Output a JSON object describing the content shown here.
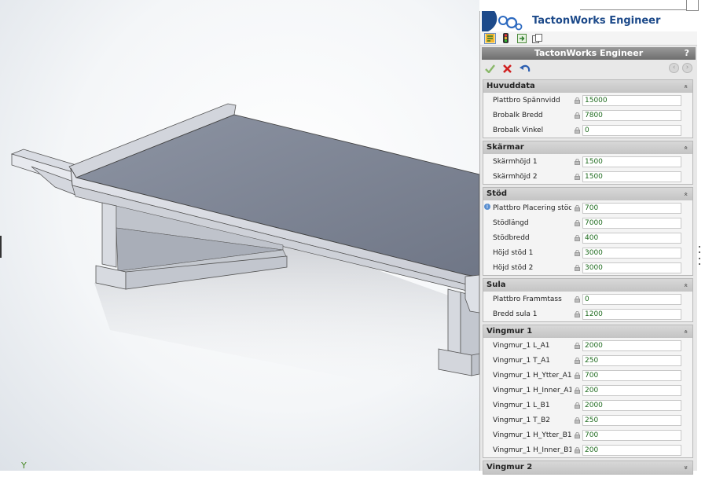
{
  "brand": {
    "name": "TactonWorks Engineer",
    "logo_icon": "tacton-logo-icon"
  },
  "toolbar": {
    "icons": [
      "configurator-icon",
      "traffic-light-icon",
      "export-icon",
      "copy-icon"
    ]
  },
  "panel": {
    "title": "TactonWorks Engineer",
    "help": "?"
  },
  "actions": {
    "accept_icon": "checkmark-icon",
    "cancel_icon": "x-icon",
    "undo_icon": "undo-icon",
    "prev_icon": "circle-left-icon",
    "next_icon": "circle-right-icon"
  },
  "colors": {
    "value_text": "#1e6b1e",
    "brand_text": "#1d4a8a",
    "title_bar": "#7a7a7a"
  },
  "groups": [
    {
      "title": "Huvuddata",
      "chevron": "«",
      "rows": [
        {
          "label": "Plattbro Spännvidd",
          "value": "15000"
        },
        {
          "label": "Brobalk Bredd",
          "value": "7800"
        },
        {
          "label": "Brobalk Vinkel",
          "value": "0"
        }
      ]
    },
    {
      "title": "Skärmar",
      "chevron": "«",
      "rows": [
        {
          "label": "Skärmhöjd 1",
          "value": "1500"
        },
        {
          "label": "Skärmhöjd 2",
          "value": "1500"
        }
      ]
    },
    {
      "title": "Stöd",
      "chevron": "«",
      "rows": [
        {
          "label": "Plattbro Placering stöd",
          "value": "700",
          "info": "i"
        },
        {
          "label": "Stödlängd",
          "value": "7000"
        },
        {
          "label": "Stödbredd",
          "value": "400"
        },
        {
          "label": "Höjd stöd 1",
          "value": "3000"
        },
        {
          "label": "Höjd stöd 2",
          "value": "3000"
        }
      ]
    },
    {
      "title": "Sula",
      "chevron": "«",
      "rows": [
        {
          "label": "Plattbro Frammtass",
          "value": "0"
        },
        {
          "label": "Bredd sula 1",
          "value": "1200"
        }
      ]
    },
    {
      "title": "Vingmur 1",
      "chevron": "«",
      "rows": [
        {
          "label": "Vingmur_1 L_A1",
          "value": "2000"
        },
        {
          "label": "Vingmur_1 T_A1",
          "value": "250"
        },
        {
          "label": "Vingmur_1 H_Ytter_A1",
          "value": "700"
        },
        {
          "label": "Vingmur_1 H_Inner_A1",
          "value": "200"
        },
        {
          "label": "Vingmur_1 L_B1",
          "value": "2000"
        },
        {
          "label": "Vingmur_1 T_B2",
          "value": "250"
        },
        {
          "label": "Vingmur_1 H_Ytter_B1",
          "value": "700"
        },
        {
          "label": "Vingmur_1 H_Inner_B1",
          "value": "200"
        }
      ]
    },
    {
      "title": "Vingmur 2",
      "chevron": "»",
      "rows": []
    }
  ],
  "viewport": {
    "axis_label": "Y"
  }
}
